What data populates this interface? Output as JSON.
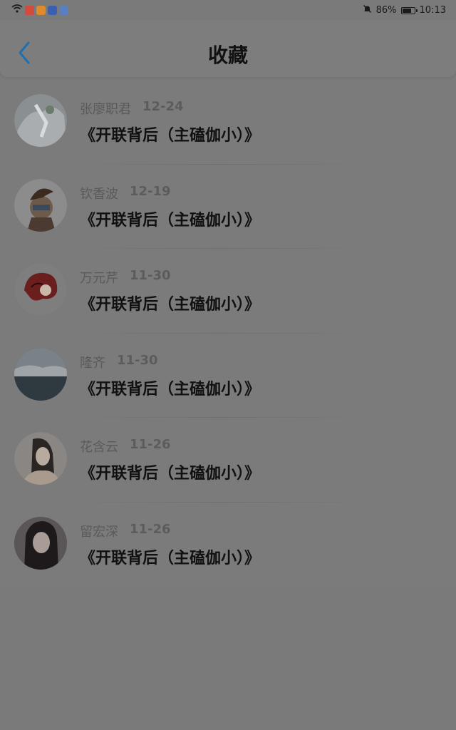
{
  "status_bar": {
    "battery_percent": "86%",
    "battery_level": 0.86,
    "time": "10:13",
    "app_icons": [
      {
        "name": "app-icon-1",
        "color": "#d44a3c"
      },
      {
        "name": "app-icon-2",
        "color": "#e08a2b"
      },
      {
        "name": "app-icon-3",
        "color": "#3a5fb0"
      },
      {
        "name": "app-icon-4",
        "color": "#5a7fc0"
      }
    ]
  },
  "header": {
    "title": "收藏",
    "back_icon": "chevron-left-icon",
    "accent": "#1f6fb0"
  },
  "items": [
    {
      "name": "张廖职君",
      "date": "12-24",
      "title": "《开联背后（主磕伽小）》"
    },
    {
      "name": "钦香波",
      "date": "12-19",
      "title": "《开联背后（主磕伽小）》"
    },
    {
      "name": "万元芹",
      "date": "11-30",
      "title": "《开联背后（主磕伽小）》"
    },
    {
      "name": "隆齐",
      "date": "11-30",
      "title": "《开联背后（主磕伽小）》"
    },
    {
      "name": "花含云",
      "date": "11-26",
      "title": "《开联背后（主磕伽小）》"
    },
    {
      "name": "留宏深",
      "date": "11-26",
      "title": "《开联背后（主磕伽小）》"
    }
  ]
}
